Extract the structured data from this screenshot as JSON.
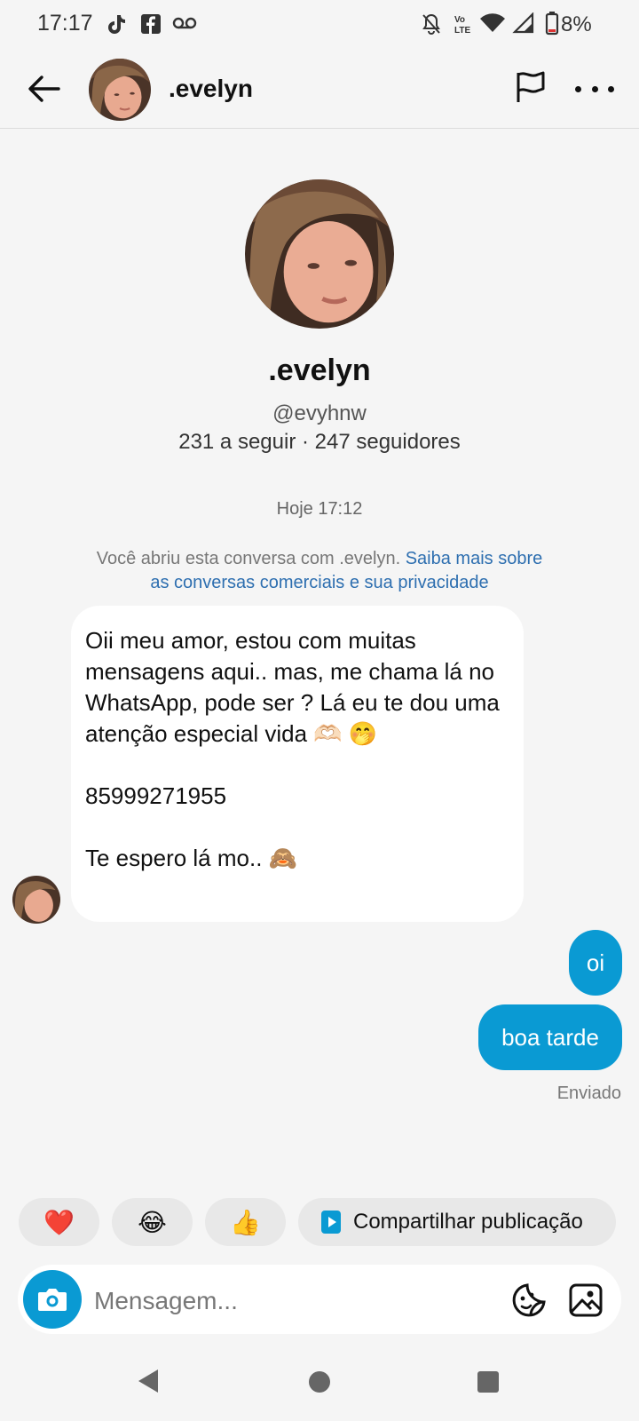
{
  "status_bar": {
    "time": "17:17",
    "battery": "8%",
    "icons": [
      "tiktok-icon",
      "facebook-icon",
      "voicemail-icon",
      "mute-icon",
      "volte-icon",
      "wifi-icon",
      "signal-icon",
      "battery-icon"
    ]
  },
  "header": {
    "name": ".evelyn"
  },
  "profile": {
    "name": ".evelyn",
    "handle": "@evyhnw",
    "stats": "231 a seguir · 247 seguidores"
  },
  "conversation": {
    "timestamp": "Hoje 17:12",
    "notice_text": "Você abriu esta conversa com .evelyn.",
    "notice_link": "Saiba mais sobre as conversas comerciais e sua privacidade",
    "received": {
      "line1": "Oii meu amor, estou com muitas mensagens aqui.. mas, me chama lá no WhatsApp, pode ser ? Lá eu te dou uma atenção especial vida 🫶🏻 🤭",
      "line2": "85999271955",
      "line3": "Te espero lá mo.. 🙈"
    },
    "sent": [
      "oi",
      "boa tarde"
    ],
    "sent_status": "Enviado"
  },
  "quick_replies": {
    "heart": "❤️",
    "laugh": "😂",
    "thumbs_up": "👍",
    "share_label": "Compartilhar publicação"
  },
  "composer": {
    "placeholder": "Mensagem..."
  },
  "colors": {
    "accent": "#0a9ad3",
    "background": "#f5f5f5",
    "link": "#2e6fb0"
  }
}
